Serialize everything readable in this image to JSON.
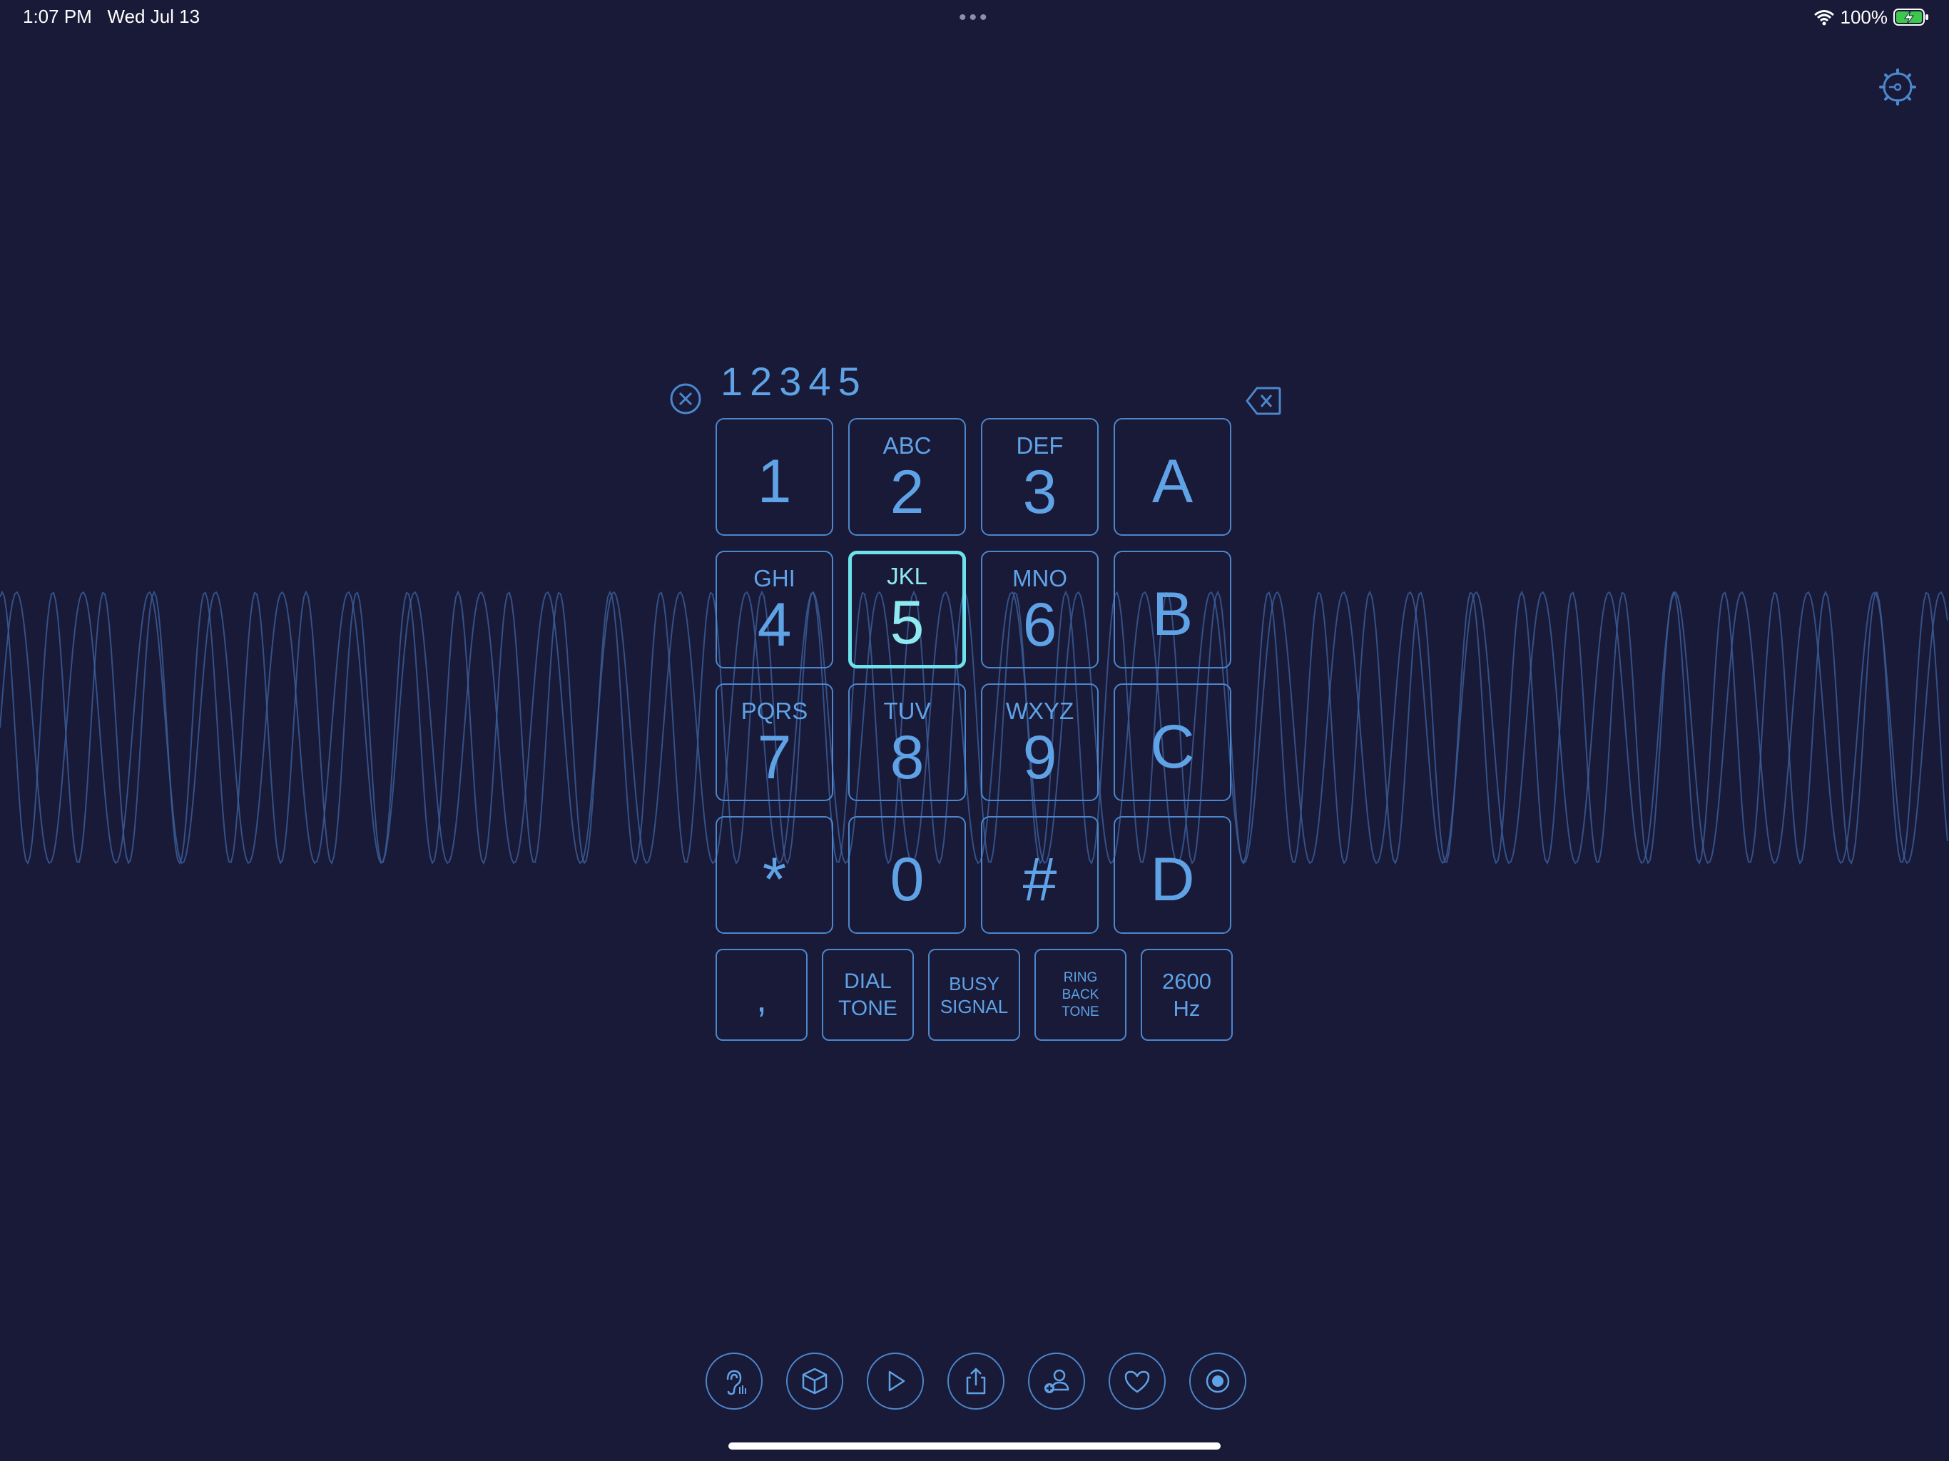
{
  "status_bar": {
    "time": "1:07 PM",
    "date": "Wed Jul 13",
    "battery_percent": "100%",
    "wifi_icon": "wifi-icon",
    "battery_icon": "battery-charging-icon",
    "more_dots": "•••"
  },
  "settings_icon": "settings-gear-icon",
  "entry": {
    "value": "12345",
    "clear_icon": "clear-circle-x-icon",
    "backspace_icon": "backspace-icon"
  },
  "keypad": {
    "active_key": "5",
    "rows": [
      [
        {
          "digit": "1",
          "letters": ""
        },
        {
          "digit": "2",
          "letters": "ABC"
        },
        {
          "digit": "3",
          "letters": "DEF"
        },
        {
          "digit": "A",
          "letters": ""
        }
      ],
      [
        {
          "digit": "4",
          "letters": "GHI"
        },
        {
          "digit": "5",
          "letters": "JKL"
        },
        {
          "digit": "6",
          "letters": "MNO"
        },
        {
          "digit": "B",
          "letters": ""
        }
      ],
      [
        {
          "digit": "7",
          "letters": "PQRS"
        },
        {
          "digit": "8",
          "letters": "TUV"
        },
        {
          "digit": "9",
          "letters": "WXYZ"
        },
        {
          "digit": "C",
          "letters": ""
        }
      ],
      [
        {
          "digit": "*",
          "letters": ""
        },
        {
          "digit": "0",
          "letters": ""
        },
        {
          "digit": "#",
          "letters": ""
        },
        {
          "digit": "D",
          "letters": ""
        }
      ]
    ]
  },
  "tones": [
    {
      "label": ",",
      "style": "comma"
    },
    {
      "label": "DIAL\nTONE",
      "style": "dial"
    },
    {
      "label": "BUSY\nSIGNAL",
      "style": "busy"
    },
    {
      "label": "RING\nBACK\nTONE",
      "style": "ring"
    },
    {
      "label": "2600\nHz",
      "style": "hz"
    }
  ],
  "toolbar": [
    {
      "icon": "hearing-accessibility-icon"
    },
    {
      "icon": "cube-icon"
    },
    {
      "icon": "play-icon"
    },
    {
      "icon": "share-icon"
    },
    {
      "icon": "add-contact-icon"
    },
    {
      "icon": "heart-icon"
    },
    {
      "icon": "record-icon"
    }
  ],
  "colors": {
    "background": "#191938",
    "accent": "#5fa3e6",
    "active": "#6de2ec",
    "wave": "#3b5f9a"
  }
}
